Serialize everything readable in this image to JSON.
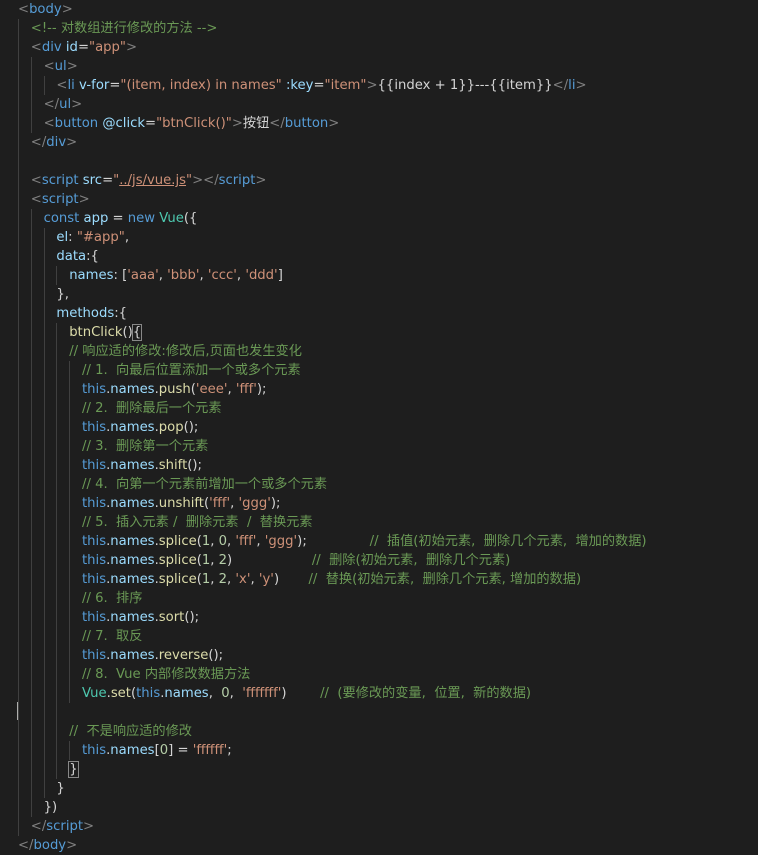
{
  "colors": {
    "background": "#1e1e1e",
    "tag": "#569cd6",
    "angle": "#808080",
    "attr": "#9cdcfe",
    "string": "#ce9178",
    "comment": "#6a9955",
    "text": "#d4d4d4",
    "keyword": "#569cd6",
    "variable": "#9cdcfe",
    "function": "#dcdcaa",
    "class": "#4ec9b0",
    "number": "#b5cea8",
    "property": "#9cdcfe"
  },
  "code_lines": [
    {
      "indent": 1,
      "tokens": [
        {
          "t": "<",
          "c": "angle"
        },
        {
          "t": "body",
          "c": "tag"
        },
        {
          "t": ">",
          "c": "angle"
        }
      ]
    },
    {
      "indent": 2,
      "tokens": [
        {
          "t": "<!-- 对数组进行修改的方法 -->",
          "c": "comment"
        }
      ]
    },
    {
      "indent": 2,
      "tokens": [
        {
          "t": "<",
          "c": "angle"
        },
        {
          "t": "div",
          "c": "tag"
        },
        {
          "t": " id",
          "c": "attr"
        },
        {
          "t": "=",
          "c": "text"
        },
        {
          "t": "\"app\"",
          "c": "string"
        },
        {
          "t": ">",
          "c": "angle"
        }
      ]
    },
    {
      "indent": 3,
      "tokens": [
        {
          "t": "<",
          "c": "angle"
        },
        {
          "t": "ul",
          "c": "tag"
        },
        {
          "t": ">",
          "c": "angle"
        }
      ]
    },
    {
      "indent": 4,
      "tokens": [
        {
          "t": "<",
          "c": "angle"
        },
        {
          "t": "li",
          "c": "tag"
        },
        {
          "t": " v-for",
          "c": "attr"
        },
        {
          "t": "=",
          "c": "text"
        },
        {
          "t": "\"(item, index) in names\"",
          "c": "string"
        },
        {
          "t": " :key",
          "c": "attr"
        },
        {
          "t": "=",
          "c": "text"
        },
        {
          "t": "\"item\"",
          "c": "string"
        },
        {
          "t": ">",
          "c": "angle"
        },
        {
          "t": "{{index + 1}}---{{item}}",
          "c": "text"
        },
        {
          "t": "</",
          "c": "angle"
        },
        {
          "t": "li",
          "c": "tag"
        },
        {
          "t": ">",
          "c": "angle"
        }
      ]
    },
    {
      "indent": 3,
      "tokens": [
        {
          "t": "</",
          "c": "angle"
        },
        {
          "t": "ul",
          "c": "tag"
        },
        {
          "t": ">",
          "c": "angle"
        }
      ]
    },
    {
      "indent": 3,
      "tokens": [
        {
          "t": "<",
          "c": "angle"
        },
        {
          "t": "button",
          "c": "tag"
        },
        {
          "t": " @click",
          "c": "attr"
        },
        {
          "t": "=",
          "c": "text"
        },
        {
          "t": "\"btnClick()\"",
          "c": "string"
        },
        {
          "t": ">",
          "c": "angle"
        },
        {
          "t": "按钮",
          "c": "text"
        },
        {
          "t": "</",
          "c": "angle"
        },
        {
          "t": "button",
          "c": "tag"
        },
        {
          "t": ">",
          "c": "angle"
        }
      ]
    },
    {
      "indent": 2,
      "tokens": [
        {
          "t": "</",
          "c": "angle"
        },
        {
          "t": "div",
          "c": "tag"
        },
        {
          "t": ">",
          "c": "angle"
        }
      ]
    },
    {
      "indent": 2,
      "tokens": []
    },
    {
      "indent": 2,
      "tokens": [
        {
          "t": "<",
          "c": "angle"
        },
        {
          "t": "script",
          "c": "tag"
        },
        {
          "t": " src",
          "c": "attr"
        },
        {
          "t": "=",
          "c": "text"
        },
        {
          "t": "\"",
          "c": "string"
        },
        {
          "t": "../js/vue.js",
          "c": "string",
          "u": true
        },
        {
          "t": "\"",
          "c": "string"
        },
        {
          "t": "></",
          "c": "angle"
        },
        {
          "t": "script",
          "c": "tag"
        },
        {
          "t": ">",
          "c": "angle"
        }
      ]
    },
    {
      "indent": 2,
      "tokens": [
        {
          "t": "<",
          "c": "angle"
        },
        {
          "t": "script",
          "c": "tag"
        },
        {
          "t": ">",
          "c": "angle"
        }
      ]
    },
    {
      "indent": 3,
      "tokens": [
        {
          "t": "const",
          "c": "keyword"
        },
        {
          "t": " app",
          "c": "variable"
        },
        {
          "t": " = ",
          "c": "text"
        },
        {
          "t": "new",
          "c": "keyword"
        },
        {
          "t": " Vue",
          "c": "class"
        },
        {
          "t": "({",
          "c": "text"
        }
      ]
    },
    {
      "indent": 4,
      "tokens": [
        {
          "t": "el",
          "c": "property"
        },
        {
          "t": ": ",
          "c": "text"
        },
        {
          "t": "\"#app\"",
          "c": "string"
        },
        {
          "t": ",",
          "c": "text"
        }
      ]
    },
    {
      "indent": 4,
      "tokens": [
        {
          "t": "data",
          "c": "property"
        },
        {
          "t": ":{",
          "c": "text"
        }
      ]
    },
    {
      "indent": 5,
      "tokens": [
        {
          "t": "names",
          "c": "property"
        },
        {
          "t": ": [",
          "c": "text"
        },
        {
          "t": "'aaa'",
          "c": "string"
        },
        {
          "t": ", ",
          "c": "text"
        },
        {
          "t": "'bbb'",
          "c": "string"
        },
        {
          "t": ", ",
          "c": "text"
        },
        {
          "t": "'ccc'",
          "c": "string"
        },
        {
          "t": ", ",
          "c": "text"
        },
        {
          "t": "'ddd'",
          "c": "string"
        },
        {
          "t": "]",
          "c": "text"
        }
      ]
    },
    {
      "indent": 4,
      "tokens": [
        {
          "t": "},",
          "c": "text"
        }
      ]
    },
    {
      "indent": 4,
      "tokens": [
        {
          "t": "methods",
          "c": "property"
        },
        {
          "t": ":{",
          "c": "text"
        }
      ]
    },
    {
      "indent": 5,
      "tokens": [
        {
          "t": "btnClick",
          "c": "function"
        },
        {
          "t": "()",
          "c": "text"
        },
        {
          "t": "{",
          "c": "text",
          "box": true
        }
      ]
    },
    {
      "indent": 5,
      "tokens": [
        {
          "t": "// 响应适的修改:修改后,页面也发生变化",
          "c": "comment"
        }
      ]
    },
    {
      "indent": 6,
      "tokens": [
        {
          "t": "// 1.  向最后位置添加一个或多个元素",
          "c": "comment"
        }
      ]
    },
    {
      "indent": 6,
      "tokens": [
        {
          "t": "this",
          "c": "keyword"
        },
        {
          "t": ".",
          "c": "text"
        },
        {
          "t": "names",
          "c": "property"
        },
        {
          "t": ".",
          "c": "text"
        },
        {
          "t": "push",
          "c": "function"
        },
        {
          "t": "(",
          "c": "text"
        },
        {
          "t": "'eee'",
          "c": "string"
        },
        {
          "t": ", ",
          "c": "text"
        },
        {
          "t": "'fff'",
          "c": "string"
        },
        {
          "t": ");",
          "c": "text"
        }
      ]
    },
    {
      "indent": 6,
      "tokens": [
        {
          "t": "// 2.  删除最后一个元素",
          "c": "comment"
        }
      ]
    },
    {
      "indent": 6,
      "tokens": [
        {
          "t": "this",
          "c": "keyword"
        },
        {
          "t": ".",
          "c": "text"
        },
        {
          "t": "names",
          "c": "property"
        },
        {
          "t": ".",
          "c": "text"
        },
        {
          "t": "pop",
          "c": "function"
        },
        {
          "t": "();",
          "c": "text"
        }
      ]
    },
    {
      "indent": 6,
      "tokens": [
        {
          "t": "// 3.  删除第一个元素",
          "c": "comment"
        }
      ]
    },
    {
      "indent": 6,
      "tokens": [
        {
          "t": "this",
          "c": "keyword"
        },
        {
          "t": ".",
          "c": "text"
        },
        {
          "t": "names",
          "c": "property"
        },
        {
          "t": ".",
          "c": "text"
        },
        {
          "t": "shift",
          "c": "function"
        },
        {
          "t": "();",
          "c": "text"
        }
      ]
    },
    {
      "indent": 6,
      "tokens": [
        {
          "t": "// 4.  向第一个元素前增加一个或多个元素",
          "c": "comment"
        }
      ]
    },
    {
      "indent": 6,
      "tokens": [
        {
          "t": "this",
          "c": "keyword"
        },
        {
          "t": ".",
          "c": "text"
        },
        {
          "t": "names",
          "c": "property"
        },
        {
          "t": ".",
          "c": "text"
        },
        {
          "t": "unshift",
          "c": "function"
        },
        {
          "t": "(",
          "c": "text"
        },
        {
          "t": "'fff'",
          "c": "string"
        },
        {
          "t": ", ",
          "c": "text"
        },
        {
          "t": "'ggg'",
          "c": "string"
        },
        {
          "t": ");",
          "c": "text"
        }
      ]
    },
    {
      "indent": 6,
      "tokens": [
        {
          "t": "// 5.  插入元素 /  删除元素  /  替换元素",
          "c": "comment"
        }
      ]
    },
    {
      "indent": 6,
      "tokens": [
        {
          "t": "this",
          "c": "keyword"
        },
        {
          "t": ".",
          "c": "text"
        },
        {
          "t": "names",
          "c": "property"
        },
        {
          "t": ".",
          "c": "text"
        },
        {
          "t": "splice",
          "c": "function"
        },
        {
          "t": "(",
          "c": "text"
        },
        {
          "t": "1",
          "c": "number"
        },
        {
          "t": ", ",
          "c": "text"
        },
        {
          "t": "0",
          "c": "number"
        },
        {
          "t": ", ",
          "c": "text"
        },
        {
          "t": "'fff'",
          "c": "string"
        },
        {
          "t": ", ",
          "c": "text"
        },
        {
          "t": "'ggg'",
          "c": "string"
        },
        {
          "t": ");               ",
          "c": "text"
        },
        {
          "t": "//  插值(初始元素,  删除几个元素,  增加的数据)",
          "c": "comment"
        }
      ]
    },
    {
      "indent": 6,
      "tokens": [
        {
          "t": "this",
          "c": "keyword"
        },
        {
          "t": ".",
          "c": "text"
        },
        {
          "t": "names",
          "c": "property"
        },
        {
          "t": ".",
          "c": "text"
        },
        {
          "t": "splice",
          "c": "function"
        },
        {
          "t": "(",
          "c": "text"
        },
        {
          "t": "1",
          "c": "number"
        },
        {
          "t": ", ",
          "c": "text"
        },
        {
          "t": "2",
          "c": "number"
        },
        {
          "t": ")                   ",
          "c": "text"
        },
        {
          "t": "//  删除(初始元素,  删除几个元素)",
          "c": "comment"
        }
      ]
    },
    {
      "indent": 6,
      "tokens": [
        {
          "t": "this",
          "c": "keyword"
        },
        {
          "t": ".",
          "c": "text"
        },
        {
          "t": "names",
          "c": "property"
        },
        {
          "t": ".",
          "c": "text"
        },
        {
          "t": "splice",
          "c": "function"
        },
        {
          "t": "(",
          "c": "text"
        },
        {
          "t": "1",
          "c": "number"
        },
        {
          "t": ", ",
          "c": "text"
        },
        {
          "t": "2",
          "c": "number"
        },
        {
          "t": ", ",
          "c": "text"
        },
        {
          "t": "'x'",
          "c": "string"
        },
        {
          "t": ", ",
          "c": "text"
        },
        {
          "t": "'y'",
          "c": "string"
        },
        {
          "t": ")       ",
          "c": "text"
        },
        {
          "t": "//  替换(初始元素,  删除几个元素, 增加的数据)",
          "c": "comment"
        }
      ]
    },
    {
      "indent": 6,
      "tokens": [
        {
          "t": "// 6.  排序",
          "c": "comment"
        }
      ]
    },
    {
      "indent": 6,
      "tokens": [
        {
          "t": "this",
          "c": "keyword"
        },
        {
          "t": ".",
          "c": "text"
        },
        {
          "t": "names",
          "c": "property"
        },
        {
          "t": ".",
          "c": "text"
        },
        {
          "t": "sort",
          "c": "function"
        },
        {
          "t": "();",
          "c": "text"
        }
      ]
    },
    {
      "indent": 6,
      "tokens": [
        {
          "t": "// 7.  取反",
          "c": "comment"
        }
      ]
    },
    {
      "indent": 6,
      "tokens": [
        {
          "t": "this",
          "c": "keyword"
        },
        {
          "t": ".",
          "c": "text"
        },
        {
          "t": "names",
          "c": "property"
        },
        {
          "t": ".",
          "c": "text"
        },
        {
          "t": "reverse",
          "c": "function"
        },
        {
          "t": "();",
          "c": "text"
        }
      ]
    },
    {
      "indent": 6,
      "tokens": [
        {
          "t": "// 8.  Vue 内部修改数据方法",
          "c": "comment"
        }
      ]
    },
    {
      "indent": 6,
      "tokens": [
        {
          "t": "Vue",
          "c": "class"
        },
        {
          "t": ".",
          "c": "text"
        },
        {
          "t": "set",
          "c": "function"
        },
        {
          "t": "(",
          "c": "text"
        },
        {
          "t": "this",
          "c": "keyword"
        },
        {
          "t": ".",
          "c": "text"
        },
        {
          "t": "names",
          "c": "property"
        },
        {
          "t": ",  ",
          "c": "text"
        },
        {
          "t": "0",
          "c": "number"
        },
        {
          "t": ",  ",
          "c": "text"
        },
        {
          "t": "'fffffff'",
          "c": "string"
        },
        {
          "t": ")        ",
          "c": "text"
        },
        {
          "t": "//  (要修改的变量,  位置,  新的数据)",
          "c": "comment"
        }
      ]
    },
    {
      "indent": 5,
      "tokens": []
    },
    {
      "indent": 5,
      "tokens": [
        {
          "t": "//  不是响应适的修改",
          "c": "comment"
        }
      ]
    },
    {
      "indent": 6,
      "tokens": [
        {
          "t": "this",
          "c": "keyword"
        },
        {
          "t": ".",
          "c": "text"
        },
        {
          "t": "names",
          "c": "property"
        },
        {
          "t": "[",
          "c": "text"
        },
        {
          "t": "0",
          "c": "number"
        },
        {
          "t": "] = ",
          "c": "text"
        },
        {
          "t": "'ffffff'",
          "c": "string"
        },
        {
          "t": ";",
          "c": "text"
        }
      ]
    },
    {
      "indent": 5,
      "tokens": [
        {
          "t": "}",
          "c": "text",
          "box": true
        }
      ]
    },
    {
      "indent": 4,
      "tokens": [
        {
          "t": "}",
          "c": "text"
        }
      ]
    },
    {
      "indent": 3,
      "tokens": [
        {
          "t": "})",
          "c": "text"
        }
      ]
    },
    {
      "indent": 2,
      "tokens": [
        {
          "t": "</",
          "c": "angle"
        },
        {
          "t": "script",
          "c": "tag"
        },
        {
          "t": ">",
          "c": "angle"
        }
      ]
    },
    {
      "indent": 1,
      "tokens": [
        {
          "t": "</",
          "c": "angle"
        },
        {
          "t": "body",
          "c": "tag"
        },
        {
          "t": ">",
          "c": "angle"
        }
      ]
    }
  ]
}
